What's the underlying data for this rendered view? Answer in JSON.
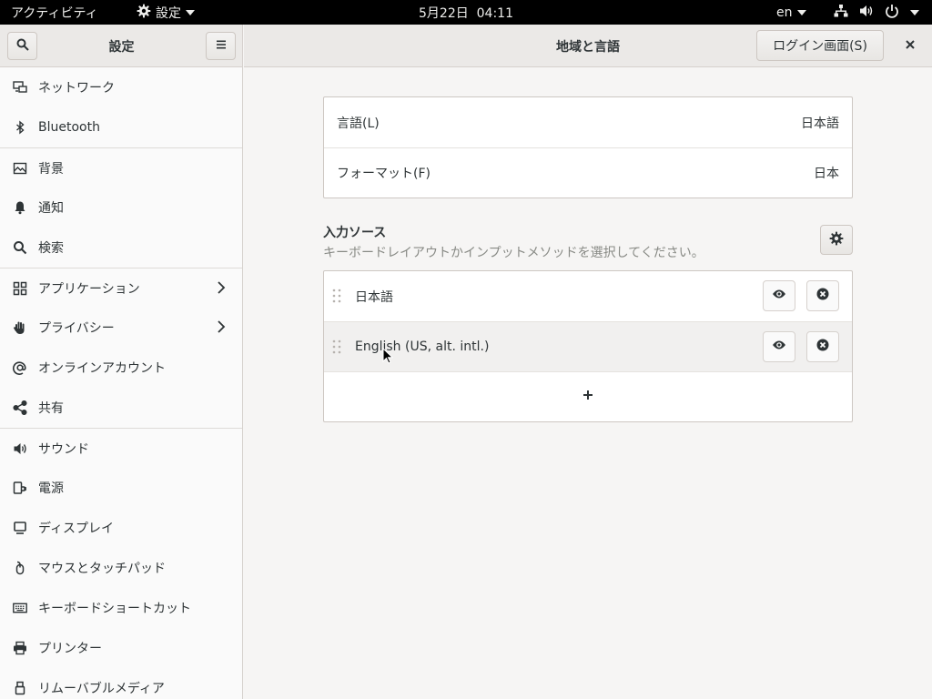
{
  "topbar": {
    "activities": "アクティビティ",
    "app_menu": "設定",
    "clock": "5月22日  04:11",
    "input_lang": "en"
  },
  "sidebar": {
    "title": "設定",
    "items": [
      {
        "label": "ネットワーク",
        "icon": "network-icon"
      },
      {
        "label": "Bluetooth",
        "icon": "bluetooth-icon"
      },
      {
        "label": "背景",
        "icon": "background-icon"
      },
      {
        "label": "通知",
        "icon": "bell-icon"
      },
      {
        "label": "検索",
        "icon": "search-icon"
      },
      {
        "label": "アプリケーション",
        "icon": "apps-grid-icon"
      },
      {
        "label": "プライバシー",
        "icon": "hand-icon"
      },
      {
        "label": "オンラインアカウント",
        "icon": "at-icon"
      },
      {
        "label": "共有",
        "icon": "share-icon"
      },
      {
        "label": "サウンド",
        "icon": "speaker-icon"
      },
      {
        "label": "電源",
        "icon": "power-plug-icon"
      },
      {
        "label": "ディスプレイ",
        "icon": "monitor-icon"
      },
      {
        "label": "マウスとタッチパッド",
        "icon": "mouse-icon"
      },
      {
        "label": "キーボードショートカット",
        "icon": "keyboard-icon"
      },
      {
        "label": "プリンター",
        "icon": "printer-icon"
      },
      {
        "label": "リムーバブルメディア",
        "icon": "usb-icon"
      }
    ]
  },
  "header": {
    "title": "地域と言語",
    "login_button": "ログイン画面(S)"
  },
  "settings": {
    "language_label": "言語(L)",
    "language_value": "日本語",
    "format_label": "フォーマット(F)",
    "format_value": "日本"
  },
  "input_sources": {
    "title": "入力ソース",
    "subtitle": "キーボードレイアウトかインプットメソッドを選択してください。",
    "sources": [
      "日本語",
      "English (US, alt. intl.)"
    ],
    "add_label": "+"
  }
}
